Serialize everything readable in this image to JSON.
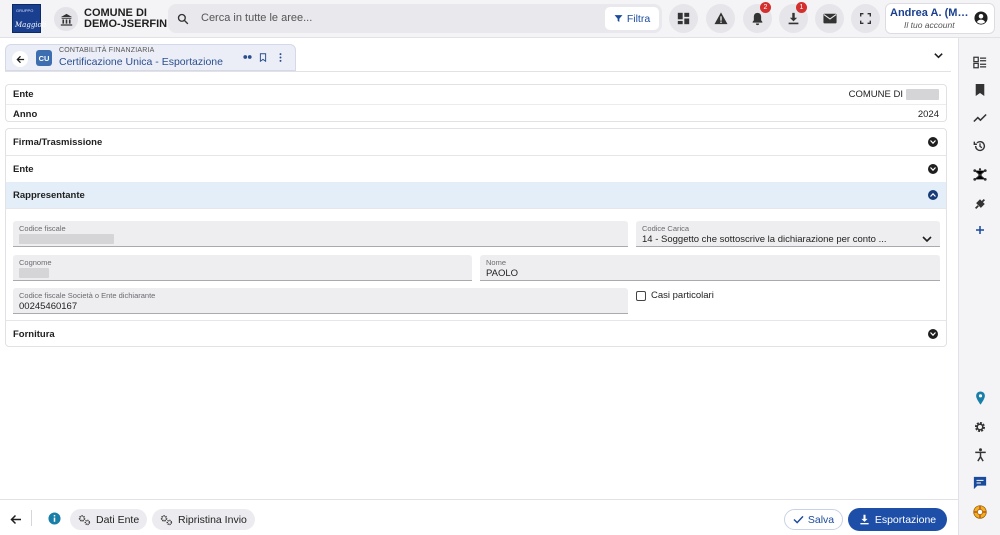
{
  "header": {
    "logo": {
      "group": "GRUPPO",
      "mark": "Maggioli"
    },
    "municipality": [
      "COMUNE DI",
      "DEMO-JSERFIN"
    ],
    "search": {
      "placeholder": "Cerca in tutte le aree...",
      "filter_label": "Filtra"
    },
    "notifications_count": "2",
    "downloads_count": "1",
    "account": {
      "name": "Andrea A. (Maggioli)",
      "subtitle": "Il tuo account"
    }
  },
  "tab": {
    "icon_text": "CU",
    "category": "CONTABILITÀ FINANZIARIA",
    "title": "Certificazione Unica - Esportazione"
  },
  "summary": [
    {
      "label": "Ente",
      "value": "COMUNE DI"
    },
    {
      "label": "Anno",
      "value": "2024"
    }
  ],
  "sections": {
    "firma": "Firma/Trasmissione",
    "ente": "Ente",
    "rappresentante": "Rappresentante",
    "fornitura": "Fornitura"
  },
  "form": {
    "codice_fiscale_label": "Codice fiscale",
    "codice_carica_label": "Codice Carica",
    "codice_carica_value": "14 - Soggetto che sottoscrive la dichiarazione per conto ...",
    "cognome_label": "Cognome",
    "nome_label": "Nome",
    "nome_value": "PAOLO",
    "cf_societa_label": "Codice fiscale Società o Ente dichiarante",
    "cf_societa_value": "00245460167",
    "casi_label": "Casi particolari"
  },
  "footer": {
    "dati_ente": "Dati Ente",
    "ripristina": "Ripristina Invio",
    "salva": "Salva",
    "esporta": "Esportazione"
  },
  "colors": {
    "primary": "#1d4fa8",
    "active_section": "#e4eef9",
    "badge": "#d32f2f"
  }
}
